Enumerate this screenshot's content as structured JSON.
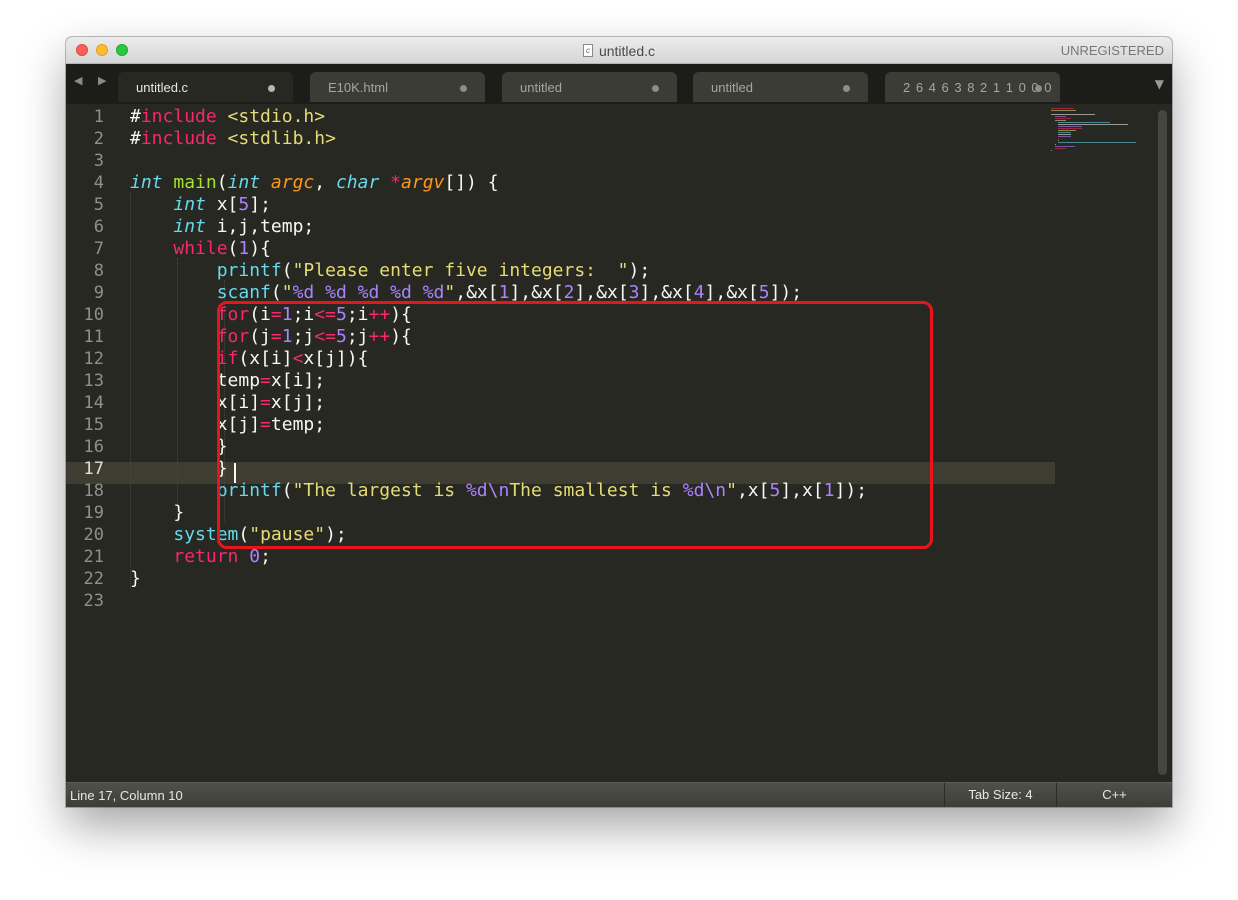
{
  "window": {
    "title": "untitled.c",
    "file_icon_glyph": "c",
    "license_label": "UNREGISTERED",
    "nav_arrows": "◀ ▶",
    "tab_menu_glyph": "▼"
  },
  "tabs": [
    {
      "label": "untitled.c",
      "active": true
    },
    {
      "label": "E10K.html",
      "active": false
    },
    {
      "label": "untitled",
      "active": false
    },
    {
      "label": "untitled",
      "active": false
    },
    {
      "label": "2 6 4 6 3 8 2 1 1 0 0 0",
      "active": false
    }
  ],
  "editor": {
    "current_line": 17,
    "line_numbers": [
      "1",
      "2",
      "3",
      "4",
      "5",
      "6",
      "7",
      "8",
      "9",
      "10",
      "11",
      "12",
      "13",
      "14",
      "15",
      "16",
      "17",
      "18",
      "19",
      "20",
      "21",
      "22",
      "23"
    ],
    "lines": [
      "#include <stdio.h>",
      "#include <stdlib.h>",
      "",
      "int main(int argc, char *argv[]) {",
      "    int x[5];",
      "    int i,j,temp;",
      "    while(1){",
      "        printf(\"Please enter five integers:  \");",
      "        scanf(\"%d %d %d %d %d\",&x[1],&x[2],&x[3],&x[4],&x[5]);",
      "        for(i=1;i<=5;i++){",
      "        for(j=1;j<=5;j++){",
      "        if(x[i]<x[j]){",
      "        temp=x[i];",
      "        x[i]=x[j];",
      "        x[j]=temp;",
      "        }",
      "        }",
      "        printf(\"The largest is %d\\nThe smallest is %d\\n\",x[5],x[1]);",
      "    }",
      "    system(\"pause\");",
      "    return 0;",
      "}",
      ""
    ],
    "colors": {
      "background": "#272822",
      "keyword": "#f92672",
      "string": "#e6db74",
      "function": "#66d9ef",
      "number": "#ae81ff",
      "highlight_box": "#e8151c"
    }
  },
  "status": {
    "position": "Line 17, Column 10",
    "tab_size": "Tab Size: 4",
    "syntax": "C++"
  }
}
